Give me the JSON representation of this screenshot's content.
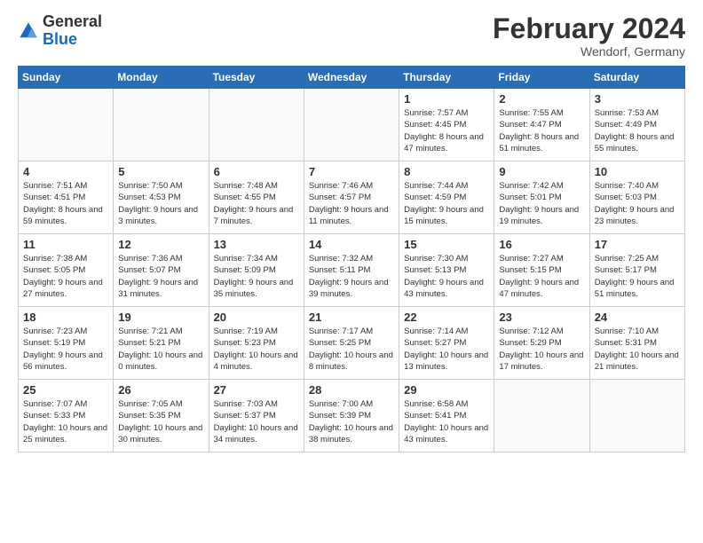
{
  "logo": {
    "general": "General",
    "blue": "Blue"
  },
  "title": "February 2024",
  "subtitle": "Wendorf, Germany",
  "headers": [
    "Sunday",
    "Monday",
    "Tuesday",
    "Wednesday",
    "Thursday",
    "Friday",
    "Saturday"
  ],
  "weeks": [
    [
      {
        "day": "",
        "empty": true
      },
      {
        "day": "",
        "empty": true
      },
      {
        "day": "",
        "empty": true
      },
      {
        "day": "",
        "empty": true
      },
      {
        "day": "1",
        "sunrise": "7:57 AM",
        "sunset": "4:45 PM",
        "daylight": "8 hours and 47 minutes."
      },
      {
        "day": "2",
        "sunrise": "7:55 AM",
        "sunset": "4:47 PM",
        "daylight": "8 hours and 51 minutes."
      },
      {
        "day": "3",
        "sunrise": "7:53 AM",
        "sunset": "4:49 PM",
        "daylight": "8 hours and 55 minutes."
      }
    ],
    [
      {
        "day": "4",
        "sunrise": "7:51 AM",
        "sunset": "4:51 PM",
        "daylight": "8 hours and 59 minutes."
      },
      {
        "day": "5",
        "sunrise": "7:50 AM",
        "sunset": "4:53 PM",
        "daylight": "9 hours and 3 minutes."
      },
      {
        "day": "6",
        "sunrise": "7:48 AM",
        "sunset": "4:55 PM",
        "daylight": "9 hours and 7 minutes."
      },
      {
        "day": "7",
        "sunrise": "7:46 AM",
        "sunset": "4:57 PM",
        "daylight": "9 hours and 11 minutes."
      },
      {
        "day": "8",
        "sunrise": "7:44 AM",
        "sunset": "4:59 PM",
        "daylight": "9 hours and 15 minutes."
      },
      {
        "day": "9",
        "sunrise": "7:42 AM",
        "sunset": "5:01 PM",
        "daylight": "9 hours and 19 minutes."
      },
      {
        "day": "10",
        "sunrise": "7:40 AM",
        "sunset": "5:03 PM",
        "daylight": "9 hours and 23 minutes."
      }
    ],
    [
      {
        "day": "11",
        "sunrise": "7:38 AM",
        "sunset": "5:05 PM",
        "daylight": "9 hours and 27 minutes."
      },
      {
        "day": "12",
        "sunrise": "7:36 AM",
        "sunset": "5:07 PM",
        "daylight": "9 hours and 31 minutes."
      },
      {
        "day": "13",
        "sunrise": "7:34 AM",
        "sunset": "5:09 PM",
        "daylight": "9 hours and 35 minutes."
      },
      {
        "day": "14",
        "sunrise": "7:32 AM",
        "sunset": "5:11 PM",
        "daylight": "9 hours and 39 minutes."
      },
      {
        "day": "15",
        "sunrise": "7:30 AM",
        "sunset": "5:13 PM",
        "daylight": "9 hours and 43 minutes."
      },
      {
        "day": "16",
        "sunrise": "7:27 AM",
        "sunset": "5:15 PM",
        "daylight": "9 hours and 47 minutes."
      },
      {
        "day": "17",
        "sunrise": "7:25 AM",
        "sunset": "5:17 PM",
        "daylight": "9 hours and 51 minutes."
      }
    ],
    [
      {
        "day": "18",
        "sunrise": "7:23 AM",
        "sunset": "5:19 PM",
        "daylight": "9 hours and 56 minutes."
      },
      {
        "day": "19",
        "sunrise": "7:21 AM",
        "sunset": "5:21 PM",
        "daylight": "10 hours and 0 minutes."
      },
      {
        "day": "20",
        "sunrise": "7:19 AM",
        "sunset": "5:23 PM",
        "daylight": "10 hours and 4 minutes."
      },
      {
        "day": "21",
        "sunrise": "7:17 AM",
        "sunset": "5:25 PM",
        "daylight": "10 hours and 8 minutes."
      },
      {
        "day": "22",
        "sunrise": "7:14 AM",
        "sunset": "5:27 PM",
        "daylight": "10 hours and 13 minutes."
      },
      {
        "day": "23",
        "sunrise": "7:12 AM",
        "sunset": "5:29 PM",
        "daylight": "10 hours and 17 minutes."
      },
      {
        "day": "24",
        "sunrise": "7:10 AM",
        "sunset": "5:31 PM",
        "daylight": "10 hours and 21 minutes."
      }
    ],
    [
      {
        "day": "25",
        "sunrise": "7:07 AM",
        "sunset": "5:33 PM",
        "daylight": "10 hours and 25 minutes."
      },
      {
        "day": "26",
        "sunrise": "7:05 AM",
        "sunset": "5:35 PM",
        "daylight": "10 hours and 30 minutes."
      },
      {
        "day": "27",
        "sunrise": "7:03 AM",
        "sunset": "5:37 PM",
        "daylight": "10 hours and 34 minutes."
      },
      {
        "day": "28",
        "sunrise": "7:00 AM",
        "sunset": "5:39 PM",
        "daylight": "10 hours and 38 minutes."
      },
      {
        "day": "29",
        "sunrise": "6:58 AM",
        "sunset": "5:41 PM",
        "daylight": "10 hours and 43 minutes."
      },
      {
        "day": "",
        "empty": true
      },
      {
        "day": "",
        "empty": true
      }
    ]
  ]
}
